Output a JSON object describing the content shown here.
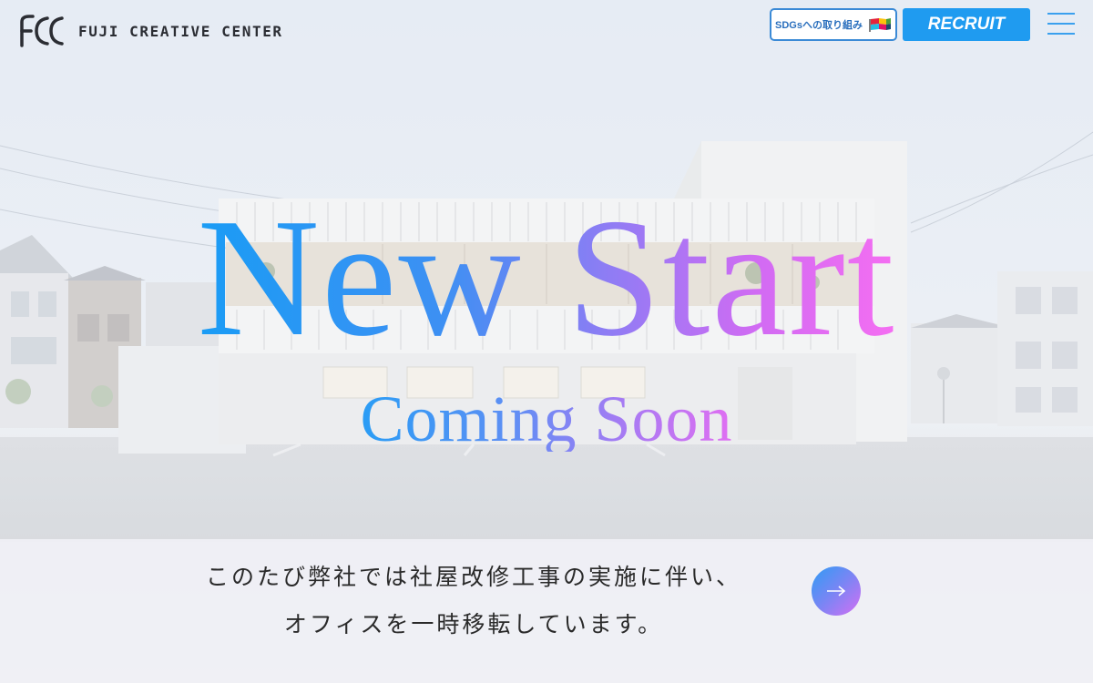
{
  "header": {
    "logo_text": "FUJI CREATIVE CENTER",
    "sdgs_label": "SDGsへの取り組み",
    "recruit_label": "RECRUIT"
  },
  "hero": {
    "headline": "New Start",
    "subheadline": "Coming Soon"
  },
  "notice": {
    "line1": "このたび弊社では社屋改修工事の実施に伴い、",
    "line2": "オフィスを一時移転しています。"
  },
  "icons": {
    "logo": "fcc-logo-icon",
    "sdgs": "sdgs-flags-icon",
    "menu": "hamburger-menu-icon",
    "arrow": "arrow-right-icon"
  },
  "colors": {
    "accent_blue": "#1f9bf0",
    "gradient_start": "#1a9cf5",
    "gradient_end": "#f56ef2"
  }
}
